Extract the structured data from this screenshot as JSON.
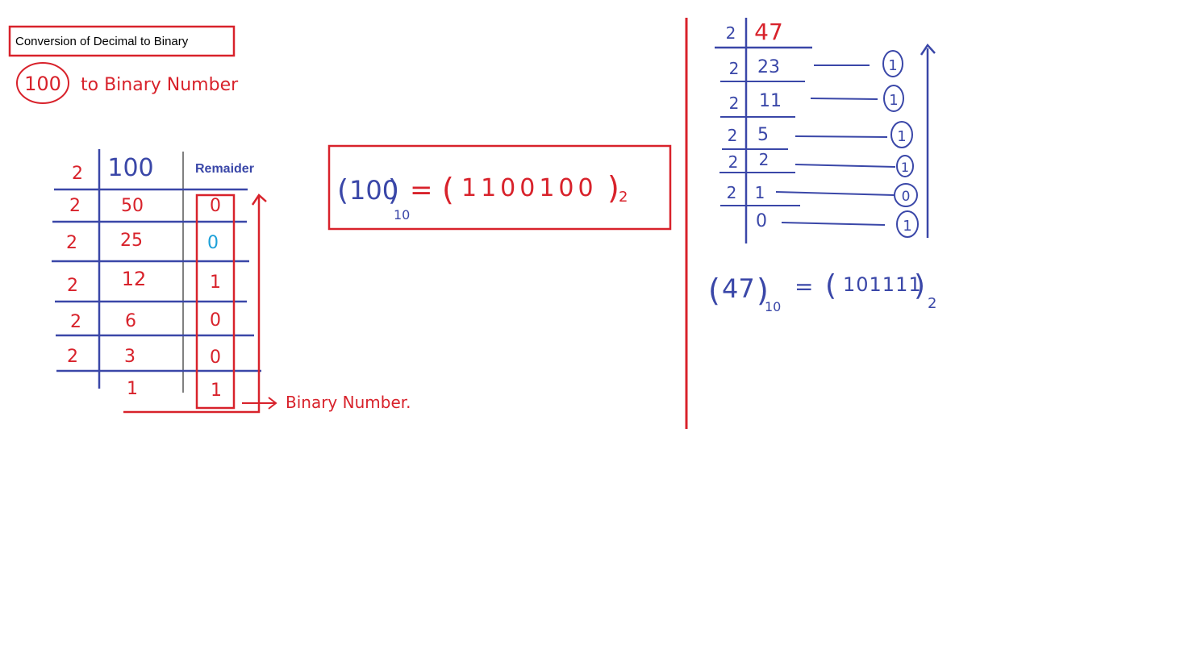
{
  "title": "Conversion of Decimal to Binary",
  "heading": {
    "number": "100",
    "text": "to Binary Number"
  },
  "colors": {
    "red": "#d8222b",
    "blue": "#3a47a8",
    "cyan": "#1ca0d8",
    "grey": "#808080"
  },
  "example_100": {
    "divisor": "2",
    "start": "100",
    "remainder_header": "Remaider",
    "rows": [
      {
        "divisor": "2",
        "quotient": "50",
        "remainder": "0"
      },
      {
        "divisor": "2",
        "quotient": "25",
        "remainder": "0"
      },
      {
        "divisor": "2",
        "quotient": "12",
        "remainder": "1"
      },
      {
        "divisor": "2",
        "quotient": "6",
        "remainder": "0"
      },
      {
        "divisor": "2",
        "quotient": "3",
        "remainder": "0"
      },
      {
        "divisor": "",
        "quotient": "1",
        "remainder": "1"
      }
    ],
    "arrow_label": "Binary Number.",
    "result": {
      "decimal": "100",
      "decimal_base": "10",
      "binary": "1100100",
      "binary_base": "2"
    }
  },
  "example_47": {
    "divisor": "2",
    "start": "47",
    "rows": [
      {
        "divisor": "2",
        "quotient": "23",
        "remainder": "1"
      },
      {
        "divisor": "2",
        "quotient": "11",
        "remainder": "1"
      },
      {
        "divisor": "2",
        "quotient": "5",
        "remainder": "1"
      },
      {
        "divisor": "2",
        "quotient": "2",
        "remainder": "1"
      },
      {
        "divisor": "2",
        "quotient": "1",
        "remainder": "0"
      },
      {
        "divisor": "",
        "quotient": "0",
        "remainder": "1"
      }
    ],
    "result": {
      "decimal": "47",
      "decimal_base": "10",
      "binary": "101111",
      "binary_base": "2"
    }
  }
}
